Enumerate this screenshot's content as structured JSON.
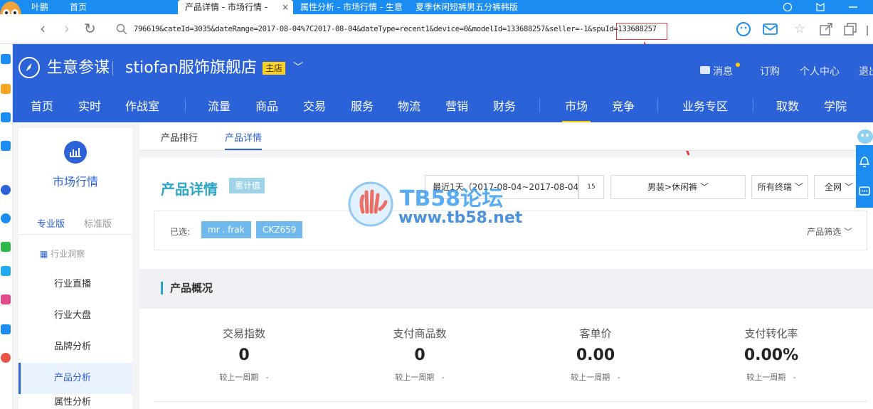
{
  "tabs": [
    {
      "label": "叶鹏"
    },
    {
      "label": "首页"
    },
    {
      "label": "产品详情 - 市场行情 -",
      "close": "×"
    },
    {
      "label": "属性分析 - 市场行情 - 生意"
    },
    {
      "label": "夏季休闲短裤男五分裤韩版"
    }
  ],
  "address": {
    "url": "796619&cateId=3035&dateRange=2017-08-04%7C2017-08-04&dateType=recent1&device=0&modelId=133688257&seller=-1&spuId=133688257"
  },
  "header": {
    "brand": "生意参谋",
    "shop": "stiofan服饰旗舰店",
    "badge": "主店",
    "right": [
      "消息",
      "订购",
      "个人中心",
      "退出"
    ]
  },
  "menu": [
    "首页",
    "实时",
    "作战室",
    "流量",
    "商品",
    "交易",
    "服务",
    "物流",
    "营销",
    "财务",
    "市场",
    "竞争",
    "业务专区",
    "取数",
    "学院"
  ],
  "left": {
    "title": "市场行情",
    "versions": [
      "专业版",
      "标准版"
    ],
    "group": "行业洞察",
    "items": [
      "行业直播",
      "行业大盘",
      "品牌分析",
      "产品分析",
      "属性分析"
    ]
  },
  "subtabs": [
    "产品排行",
    "产品详情"
  ],
  "content": {
    "title": "产品详情",
    "tag": "累计值",
    "date": "最近1天（2017-08-04~2017-08-04）",
    "date_icon": "15",
    "category": "男装>休闲裤",
    "terminal": "所有终端",
    "network": "全网",
    "selected_label": "已选:",
    "chips": [
      "mr . frak",
      "CKZ659"
    ],
    "filter": "产品筛选",
    "overview": "产品概况",
    "kpis": [
      {
        "label": "交易指数",
        "value": "0",
        "cmp": "较上一周期",
        "cmpv": "-"
      },
      {
        "label": "支付商品数",
        "value": "0",
        "cmp": "较上一周期",
        "cmpv": "-"
      },
      {
        "label": "客单价",
        "value": "0.00",
        "cmp": "较上一周期",
        "cmpv": "-"
      },
      {
        "label": "支付转化率",
        "value": "0.00%",
        "cmp": "较上一周期",
        "cmpv": "-"
      }
    ]
  },
  "watermark": {
    "line1": "TB58论坛",
    "line2": "www.tb58.net"
  },
  "colors": {
    "primary": "#2c62d8",
    "tabbar": "#1b8cf0",
    "annotation": "#e23b3b",
    "accent": "#ffcc00"
  },
  "icons": [
    "owl-avatar-icon",
    "back-icon",
    "forward-icon",
    "refresh-icon",
    "search-icon",
    "emoji-icon",
    "mail-icon",
    "star-icon",
    "share-icon",
    "window-icon",
    "compass-icon",
    "calendar-icon",
    "bell-icon",
    "chat-icon",
    "chart-icon"
  ]
}
